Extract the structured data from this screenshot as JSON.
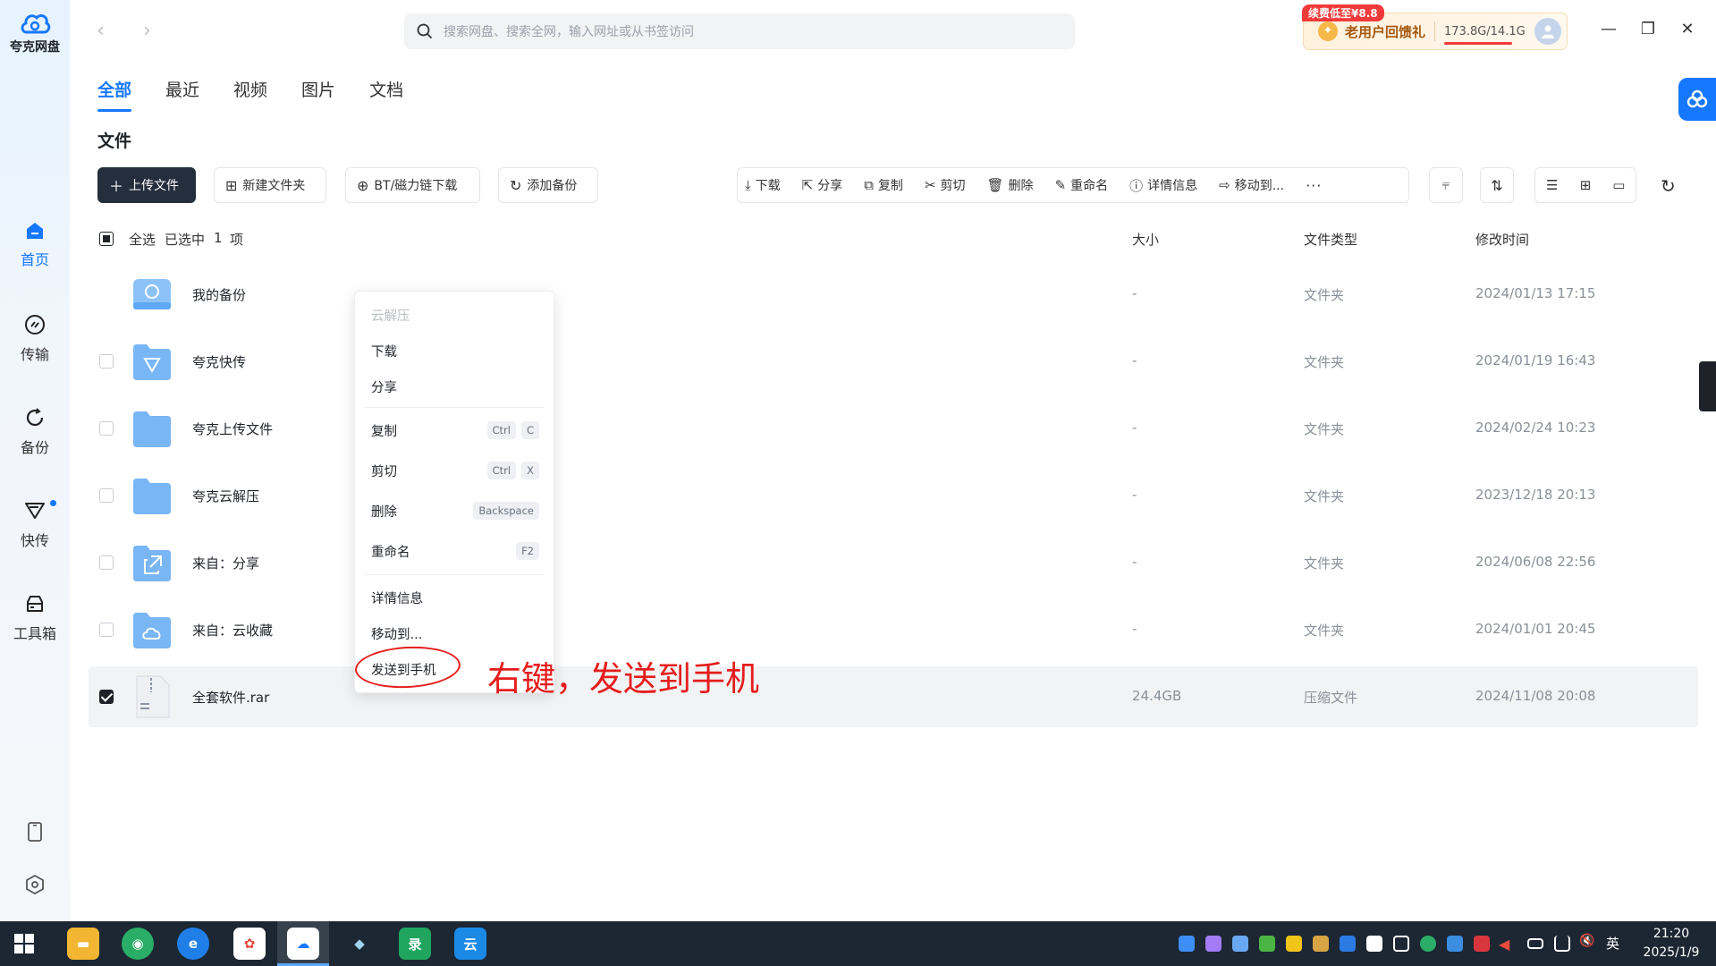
{
  "app": {
    "name": "夸克网盘"
  },
  "sidebar": {
    "items": [
      {
        "label": "首页",
        "icon": "home-icon",
        "active": true
      },
      {
        "label": "传输",
        "icon": "transfer-icon",
        "active": false
      },
      {
        "label": "备份",
        "icon": "backup-icon",
        "active": false
      },
      {
        "label": "快传",
        "icon": "quick-send-icon",
        "active": false
      },
      {
        "label": "工具箱",
        "icon": "toolbox-icon",
        "active": false
      }
    ],
    "bottom_icons": [
      "phone-icon",
      "settings-icon"
    ]
  },
  "search": {
    "placeholder": "搜索网盘、搜索全网，输入网址或从书签访问"
  },
  "promo": {
    "badge": "续费低至¥8.8",
    "text": "老用户回馈礼",
    "storage": "173.8G/14.1G",
    "usage_fraction": 1.0
  },
  "tabs": [
    {
      "label": "全部",
      "active": true
    },
    {
      "label": "最近",
      "active": false
    },
    {
      "label": "视频",
      "active": false
    },
    {
      "label": "图片",
      "active": false
    },
    {
      "label": "文档",
      "active": false
    }
  ],
  "section_title": "文件",
  "actions": {
    "upload": "上传文件",
    "new_folder": "新建文件夹",
    "bt_download": "BT/磁力链下载",
    "add_backup": "添加备份"
  },
  "ops": {
    "download": "下载",
    "share": "分享",
    "copy": "复制",
    "cut": "剪切",
    "delete": "删除",
    "rename": "重命名",
    "details": "详情信息",
    "move": "移动到...",
    "more": "···"
  },
  "list": {
    "select_all": "全选",
    "selected_prefix": "已选中",
    "selected_count": "1",
    "selected_suffix": "项",
    "columns": {
      "size": "大小",
      "type": "文件类型",
      "modified": "修改时间"
    },
    "rows": [
      {
        "name": "我的备份",
        "size": "-",
        "type": "文件夹",
        "modified": "2024/01/13 17:15",
        "icon": "backup-drive-icon",
        "checked": false
      },
      {
        "name": "夸克快传",
        "size": "-",
        "type": "文件夹",
        "modified": "2024/01/19 16:43",
        "icon": "folder-send-icon",
        "checked": false
      },
      {
        "name": "夸克上传文件",
        "size": "-",
        "type": "文件夹",
        "modified": "2024/02/24 10:23",
        "icon": "folder-icon",
        "checked": false
      },
      {
        "name": "夸克云解压",
        "size": "-",
        "type": "文件夹",
        "modified": "2023/12/18 20:13",
        "icon": "folder-icon",
        "checked": false
      },
      {
        "name": "来自：分享",
        "size": "-",
        "type": "文件夹",
        "modified": "2024/06/08 22:56",
        "icon": "folder-share-icon",
        "checked": false
      },
      {
        "name": "来自：云收藏",
        "size": "-",
        "type": "文件夹",
        "modified": "2024/01/01 20:45",
        "icon": "folder-cloud-icon",
        "checked": false
      },
      {
        "name": "全套软件.rar",
        "size": "24.4GB",
        "type": "压缩文件",
        "modified": "2024/11/08 20:08",
        "icon": "archive-file-icon",
        "checked": true
      }
    ]
  },
  "context_menu": {
    "items": [
      {
        "label": "云解压",
        "disabled": true
      },
      {
        "label": "下载"
      },
      {
        "label": "分享"
      },
      {
        "label": "复制",
        "keys": [
          "Ctrl",
          "C"
        ]
      },
      {
        "label": "剪切",
        "keys": [
          "Ctrl",
          "X"
        ]
      },
      {
        "label": "删除",
        "keys": [
          "Backspace"
        ]
      },
      {
        "label": "重命名",
        "keys": [
          "F2"
        ]
      },
      {
        "label": "详情信息"
      },
      {
        "label": "移动到..."
      },
      {
        "label": "发送到手机"
      }
    ]
  },
  "annotation": {
    "text": "右键，发送到手机",
    "color": "#e51d1d"
  },
  "taskbar": {
    "ime": "英",
    "time": "21:20",
    "date": "2025/1/9",
    "quick_app_label": "录",
    "quick_app_label2": "云"
  },
  "colors": {
    "accent": "#1677ff",
    "dark_button": "#252e3d",
    "annotation": "#e51d1d"
  }
}
